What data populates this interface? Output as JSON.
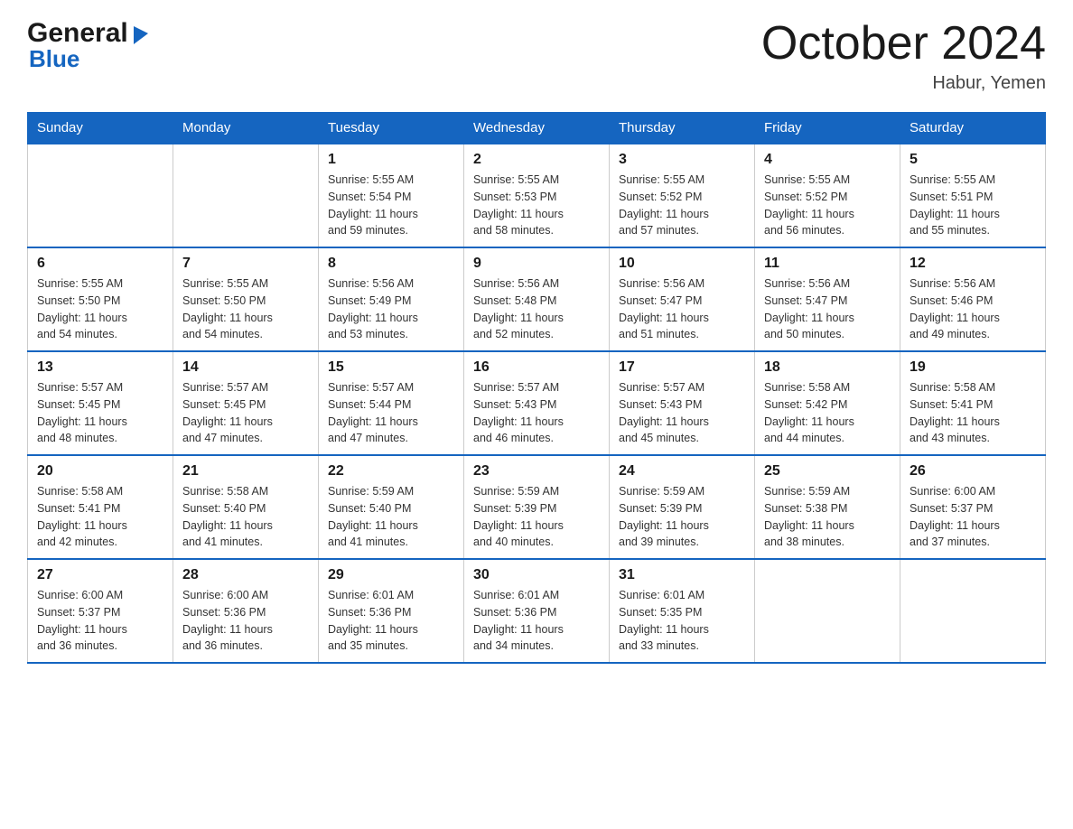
{
  "header": {
    "logo_general": "General",
    "logo_blue": "Blue",
    "title": "October 2024",
    "subtitle": "Habur, Yemen"
  },
  "days_of_week": [
    "Sunday",
    "Monday",
    "Tuesday",
    "Wednesday",
    "Thursday",
    "Friday",
    "Saturday"
  ],
  "weeks": [
    [
      {
        "day": "",
        "info": ""
      },
      {
        "day": "",
        "info": ""
      },
      {
        "day": "1",
        "info": "Sunrise: 5:55 AM\nSunset: 5:54 PM\nDaylight: 11 hours\nand 59 minutes."
      },
      {
        "day": "2",
        "info": "Sunrise: 5:55 AM\nSunset: 5:53 PM\nDaylight: 11 hours\nand 58 minutes."
      },
      {
        "day": "3",
        "info": "Sunrise: 5:55 AM\nSunset: 5:52 PM\nDaylight: 11 hours\nand 57 minutes."
      },
      {
        "day": "4",
        "info": "Sunrise: 5:55 AM\nSunset: 5:52 PM\nDaylight: 11 hours\nand 56 minutes."
      },
      {
        "day": "5",
        "info": "Sunrise: 5:55 AM\nSunset: 5:51 PM\nDaylight: 11 hours\nand 55 minutes."
      }
    ],
    [
      {
        "day": "6",
        "info": "Sunrise: 5:55 AM\nSunset: 5:50 PM\nDaylight: 11 hours\nand 54 minutes."
      },
      {
        "day": "7",
        "info": "Sunrise: 5:55 AM\nSunset: 5:50 PM\nDaylight: 11 hours\nand 54 minutes."
      },
      {
        "day": "8",
        "info": "Sunrise: 5:56 AM\nSunset: 5:49 PM\nDaylight: 11 hours\nand 53 minutes."
      },
      {
        "day": "9",
        "info": "Sunrise: 5:56 AM\nSunset: 5:48 PM\nDaylight: 11 hours\nand 52 minutes."
      },
      {
        "day": "10",
        "info": "Sunrise: 5:56 AM\nSunset: 5:47 PM\nDaylight: 11 hours\nand 51 minutes."
      },
      {
        "day": "11",
        "info": "Sunrise: 5:56 AM\nSunset: 5:47 PM\nDaylight: 11 hours\nand 50 minutes."
      },
      {
        "day": "12",
        "info": "Sunrise: 5:56 AM\nSunset: 5:46 PM\nDaylight: 11 hours\nand 49 minutes."
      }
    ],
    [
      {
        "day": "13",
        "info": "Sunrise: 5:57 AM\nSunset: 5:45 PM\nDaylight: 11 hours\nand 48 minutes."
      },
      {
        "day": "14",
        "info": "Sunrise: 5:57 AM\nSunset: 5:45 PM\nDaylight: 11 hours\nand 47 minutes."
      },
      {
        "day": "15",
        "info": "Sunrise: 5:57 AM\nSunset: 5:44 PM\nDaylight: 11 hours\nand 47 minutes."
      },
      {
        "day": "16",
        "info": "Sunrise: 5:57 AM\nSunset: 5:43 PM\nDaylight: 11 hours\nand 46 minutes."
      },
      {
        "day": "17",
        "info": "Sunrise: 5:57 AM\nSunset: 5:43 PM\nDaylight: 11 hours\nand 45 minutes."
      },
      {
        "day": "18",
        "info": "Sunrise: 5:58 AM\nSunset: 5:42 PM\nDaylight: 11 hours\nand 44 minutes."
      },
      {
        "day": "19",
        "info": "Sunrise: 5:58 AM\nSunset: 5:41 PM\nDaylight: 11 hours\nand 43 minutes."
      }
    ],
    [
      {
        "day": "20",
        "info": "Sunrise: 5:58 AM\nSunset: 5:41 PM\nDaylight: 11 hours\nand 42 minutes."
      },
      {
        "day": "21",
        "info": "Sunrise: 5:58 AM\nSunset: 5:40 PM\nDaylight: 11 hours\nand 41 minutes."
      },
      {
        "day": "22",
        "info": "Sunrise: 5:59 AM\nSunset: 5:40 PM\nDaylight: 11 hours\nand 41 minutes."
      },
      {
        "day": "23",
        "info": "Sunrise: 5:59 AM\nSunset: 5:39 PM\nDaylight: 11 hours\nand 40 minutes."
      },
      {
        "day": "24",
        "info": "Sunrise: 5:59 AM\nSunset: 5:39 PM\nDaylight: 11 hours\nand 39 minutes."
      },
      {
        "day": "25",
        "info": "Sunrise: 5:59 AM\nSunset: 5:38 PM\nDaylight: 11 hours\nand 38 minutes."
      },
      {
        "day": "26",
        "info": "Sunrise: 6:00 AM\nSunset: 5:37 PM\nDaylight: 11 hours\nand 37 minutes."
      }
    ],
    [
      {
        "day": "27",
        "info": "Sunrise: 6:00 AM\nSunset: 5:37 PM\nDaylight: 11 hours\nand 36 minutes."
      },
      {
        "day": "28",
        "info": "Sunrise: 6:00 AM\nSunset: 5:36 PM\nDaylight: 11 hours\nand 36 minutes."
      },
      {
        "day": "29",
        "info": "Sunrise: 6:01 AM\nSunset: 5:36 PM\nDaylight: 11 hours\nand 35 minutes."
      },
      {
        "day": "30",
        "info": "Sunrise: 6:01 AM\nSunset: 5:36 PM\nDaylight: 11 hours\nand 34 minutes."
      },
      {
        "day": "31",
        "info": "Sunrise: 6:01 AM\nSunset: 5:35 PM\nDaylight: 11 hours\nand 33 minutes."
      },
      {
        "day": "",
        "info": ""
      },
      {
        "day": "",
        "info": ""
      }
    ]
  ]
}
